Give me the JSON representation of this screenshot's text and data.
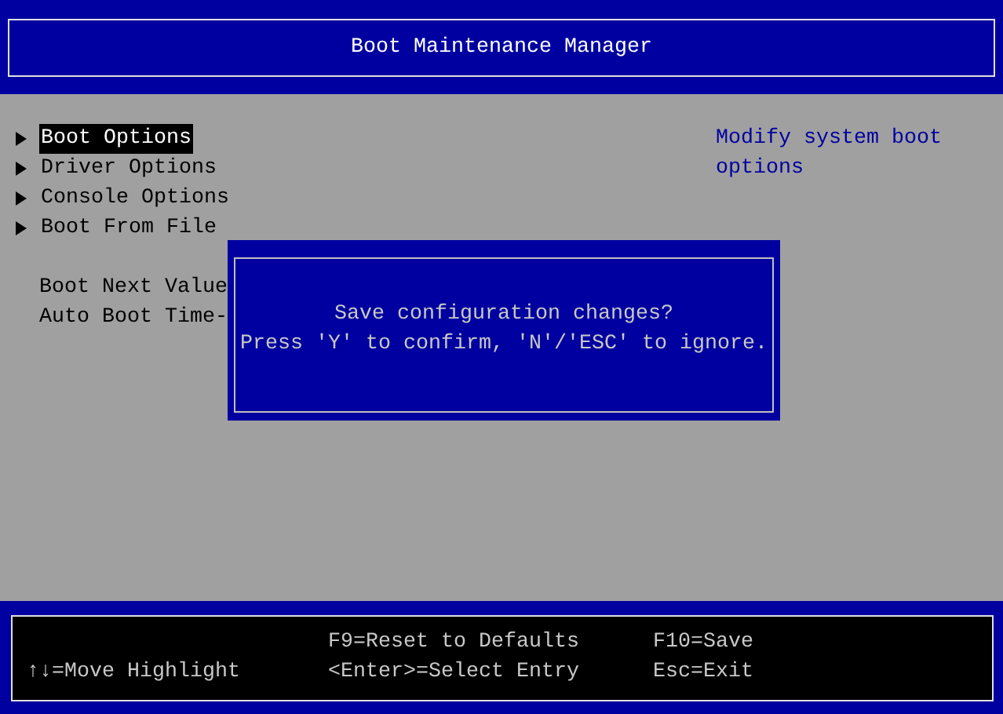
{
  "header": {
    "title": "Boot Maintenance Manager"
  },
  "menu": {
    "links": [
      {
        "label": "Boot Options",
        "selected": true
      },
      {
        "label": "Driver Options",
        "selected": false
      },
      {
        "label": "Console Options",
        "selected": false
      },
      {
        "label": "Boot From File",
        "selected": false
      }
    ],
    "settings": [
      {
        "label": "Boot Next Value"
      },
      {
        "label": "Auto Boot Time-"
      }
    ]
  },
  "help_text": "Modify system boot options",
  "dialog": {
    "lines": [
      "Save configuration changes?",
      "Press 'Y' to confirm, 'N'/'ESC' to ignore."
    ]
  },
  "footer": {
    "columns": [
      [
        "↑↓=Move Highlight"
      ],
      [
        "F9=Reset to Defaults",
        "<Enter>=Select Entry"
      ],
      [
        "F10=Save",
        "Esc=Exit"
      ]
    ]
  }
}
